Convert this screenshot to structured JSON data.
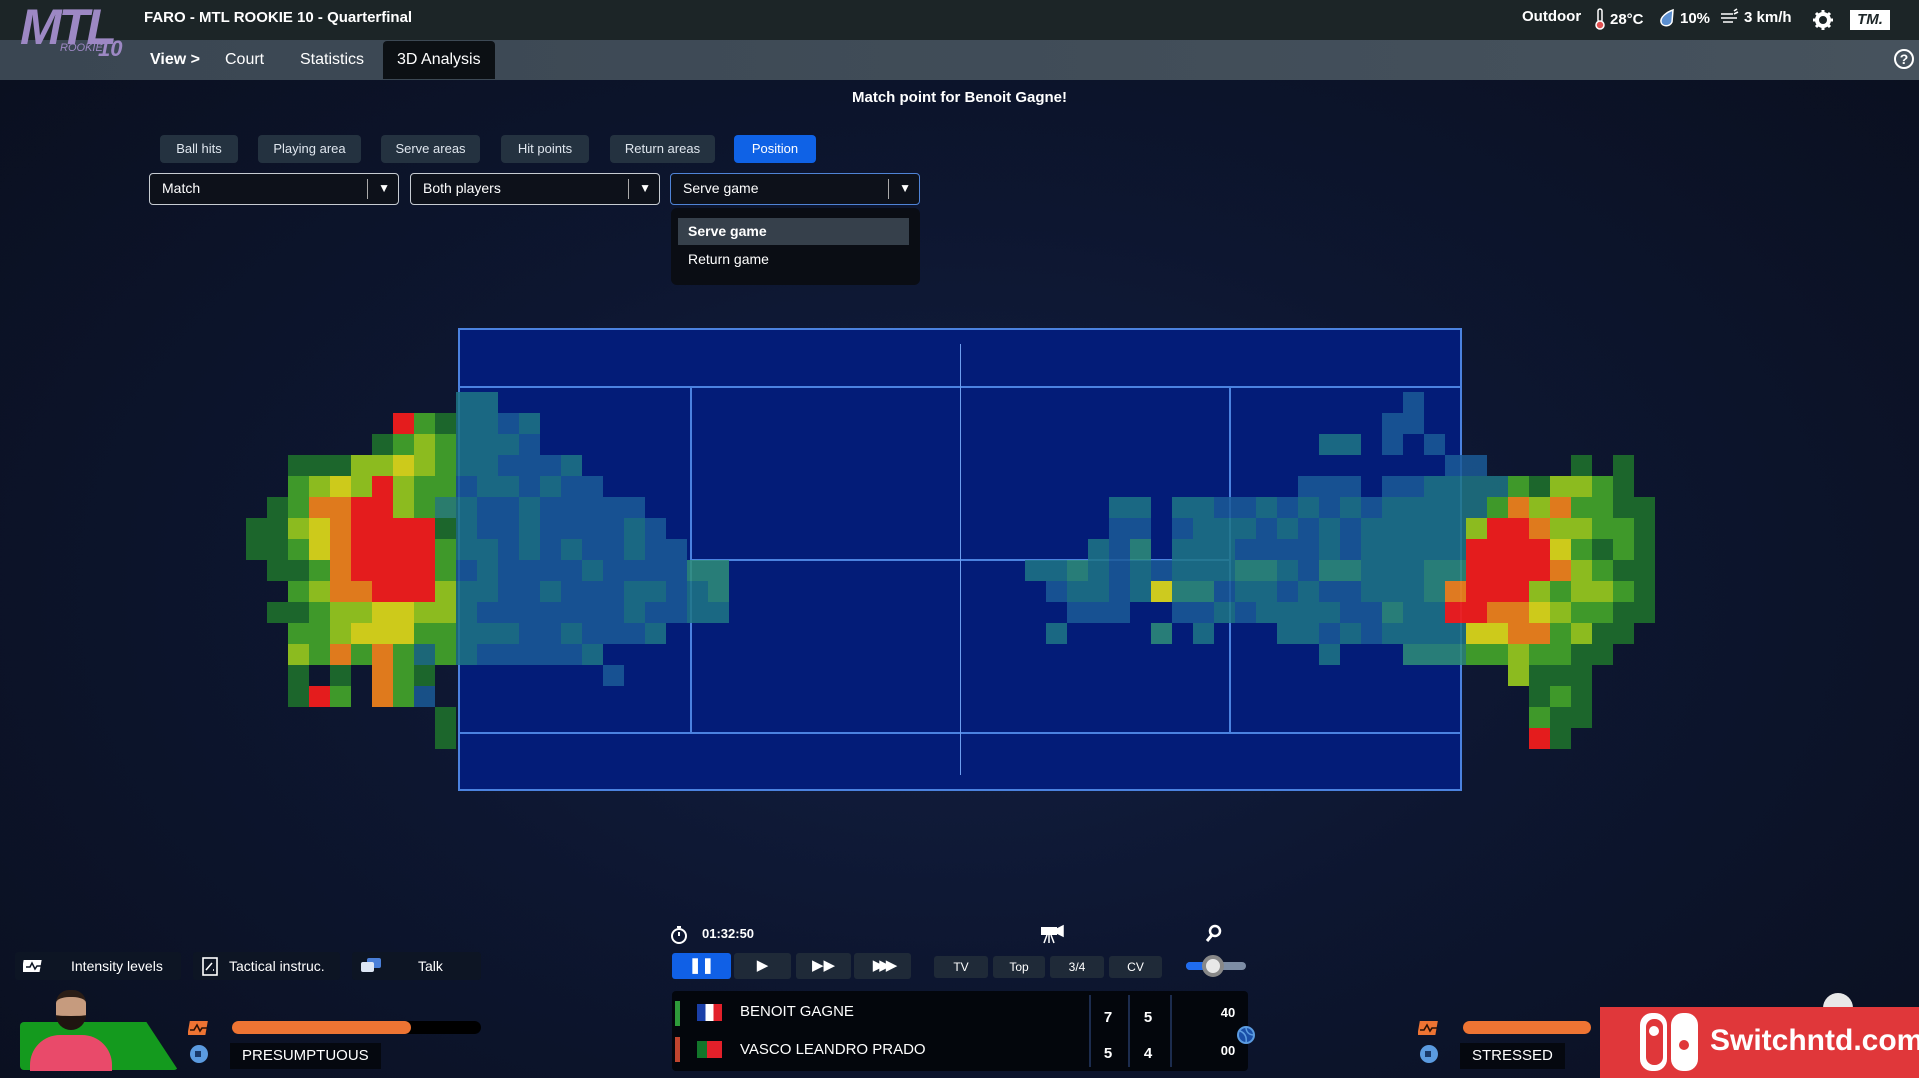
{
  "app": {
    "logo": "MTL",
    "logo_sub": "ROOKIE",
    "logo_num": "10",
    "title": "FARO - MTL ROOKIE 10 - Quarterfinal"
  },
  "nav": {
    "items": [
      {
        "label": "View >"
      },
      {
        "label": "Court"
      },
      {
        "label": "Statistics"
      },
      {
        "label": "3D Analysis",
        "active": true
      }
    ]
  },
  "weather": {
    "condition": "Outdoor",
    "temperature": "28°C",
    "humidity": "10%",
    "wind": "3 km/h",
    "icons": [
      "thermometer-icon",
      "raindrop-icon",
      "wind-icon",
      "gear-icon"
    ],
    "brand": "TM."
  },
  "message": "Match point for Benoit Gagne!",
  "tabs": [
    {
      "label": "Ball hits"
    },
    {
      "label": "Playing area"
    },
    {
      "label": "Serve areas"
    },
    {
      "label": "Hit points"
    },
    {
      "label": "Return areas"
    },
    {
      "label": "Position",
      "active": true
    }
  ],
  "filters": {
    "period": "Match",
    "players": "Both players",
    "game_type": "Serve game",
    "game_type_options": [
      "Serve game",
      "Return game"
    ]
  },
  "colors": {
    "accent": "#0f62e6",
    "court": "#031c78",
    "court_lines": "#4b82e0",
    "energy": "#ee7433",
    "heat": [
      "transparent",
      "#1b5a96",
      "#1f7585",
      "#2f8e78",
      "#1d6a2c",
      "#42a02a",
      "#94c41f",
      "#d8d41a",
      "#eb7f1c",
      "#f01c1c"
    ]
  },
  "heatmap": {
    "scale": "0-9 intensity",
    "left_rows": [
      "000000000002200000000000000000",
      "000000009542212000000000000000",
      "000000045652221000000000000000",
      "000444667652211120000000000000",
      "000567696551221211000000000000",
      "004588996532112111110000000000",
      "044678999942112111121000000000",
      "044578999952212121121100000000",
      "004458999951211112111133000000",
      "000568899962211211122123000000",
      "004456677662111111121122000000",
      "000556777552221121112000000000",
      "000658585252111112000000000000",
      "000404085400000000100000000000",
      "000495085100000000000000000000",
      "000000000040000000000000000000",
      "000000000040000000000000000000"
    ],
    "right_rows": [
      "000000000000000000100000000000",
      "000000000000000001100000000000",
      "000000000000002201010000000000",
      "000000000000000000001100004040",
      "000000000000011101122225466540",
      "000022022112121212222258685544",
      "000011012221212122222699866554",
      "000213022211112122222999975454",
      "223212122233213322233999986544",
      "012212733122121122238999656654",
      "001110011212222113229988765544",
      "020000302000221212222778856440",
      "000000000000002000333556554400",
      "000000000000000000000006444000",
      "000000000000000000000000454000",
      "000000000000000000000000544000",
      "000000000000000000000000940000"
    ]
  },
  "bottom": {
    "buttons": [
      {
        "label": "Intensity levels",
        "icon": "intensity-icon"
      },
      {
        "label": "Tactical instruc.",
        "icon": "clipboard-icon"
      },
      {
        "label": "Talk",
        "icon": "chat-icon"
      }
    ],
    "left_player": {
      "mood": "PRESUMPTUOUS",
      "energy_pct": 72
    },
    "right_player": {
      "mood": "STRESSED",
      "energy_pct": 100
    }
  },
  "playback": {
    "time": "01:32:50",
    "controls": [
      "pause",
      "play",
      "fast",
      "faster"
    ],
    "active": "pause",
    "cameras": [
      "TV",
      "Top",
      "3/4",
      "CV"
    ],
    "zoom_pct": 45
  },
  "scoreboard": {
    "players": [
      {
        "name": "BENOIT GAGNE",
        "flag": "France",
        "sets": [
          "7",
          "5"
        ],
        "points": "40",
        "color": "#2e9a3a"
      },
      {
        "name": "VASCO LEANDRO PRADO",
        "flag": "Portugal",
        "sets": [
          "5",
          "4"
        ],
        "points": "00",
        "color": "#c0452f"
      }
    ]
  },
  "watermark": "Switchntd.com"
}
